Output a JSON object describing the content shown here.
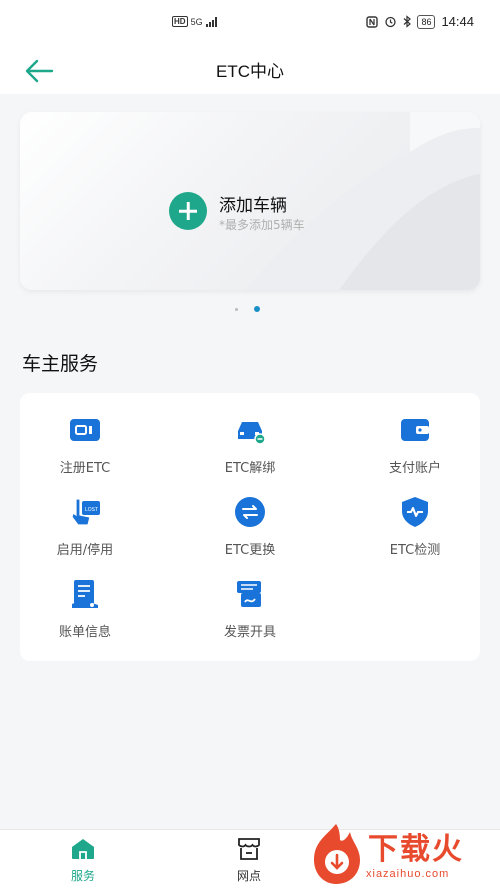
{
  "status_bar": {
    "hd": "HD",
    "network": "5G",
    "battery": "86",
    "time": "14:44"
  },
  "header": {
    "title": "ETC中心"
  },
  "banner": {
    "add_title": "添加车辆",
    "add_sub": "*最多添加5辆车",
    "page_count": 2,
    "active_page": 2
  },
  "section": {
    "title": "车主服务"
  },
  "services": [
    {
      "label": "注册ETC",
      "icon": "card-icon"
    },
    {
      "label": "ETC解绑",
      "icon": "car-icon"
    },
    {
      "label": "支付账户",
      "icon": "wallet-icon"
    },
    {
      "label": "启用/停用",
      "icon": "hand-pointer-icon"
    },
    {
      "label": "ETC更换",
      "icon": "swap-icon"
    },
    {
      "label": "ETC检测",
      "icon": "shield-check-icon"
    },
    {
      "label": "账单信息",
      "icon": "bill-icon"
    },
    {
      "label": "发票开具",
      "icon": "invoice-icon"
    }
  ],
  "bottom_nav": {
    "items": [
      {
        "label": "服务",
        "icon": "home-icon",
        "active": true
      },
      {
        "label": "网点",
        "icon": "store-icon",
        "active": false
      }
    ]
  },
  "watermark": {
    "text": "下载火",
    "url": "xiazaihuo.com"
  },
  "colors": {
    "accent": "#1ea78a",
    "icon_blue": "#1a73d9",
    "dot_active": "#1a8fc7"
  }
}
